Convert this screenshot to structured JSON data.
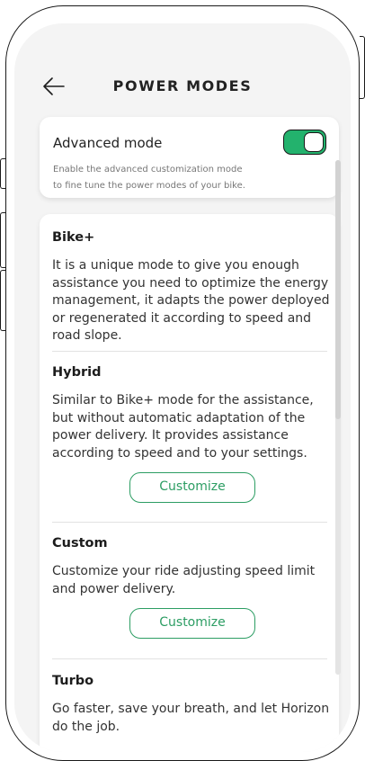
{
  "header": {
    "title": "POWER MODES",
    "back_icon": "arrow-left-icon"
  },
  "advanced": {
    "title": "Advanced mode",
    "description_line1": "Enable the advanced customization mode",
    "description_line2": "to fine tune the power modes of your bike.",
    "enabled": true
  },
  "modes": [
    {
      "title": "Bike+",
      "description": "It is a unique mode to give you enough assistance you need to optimize the energy management, it adapts the power deployed or regenerated it according to speed and road slope."
    },
    {
      "title": "Hybrid",
      "description": "Similar to Bike+ mode for the assistance, but without automatic adaptation of the power delivery. It provides assistance according to speed and to your settings.",
      "button": "Customize"
    },
    {
      "title": "Custom",
      "description": "Customize your ride adjusting speed limit and power delivery.",
      "button": "Customize"
    },
    {
      "title": "Turbo",
      "description": "Go faster, save your breath, and let Horizon do the job."
    }
  ],
  "colors": {
    "accent": "#23b26d",
    "button_text": "#2c9d63",
    "background": "#f4f4f4"
  }
}
